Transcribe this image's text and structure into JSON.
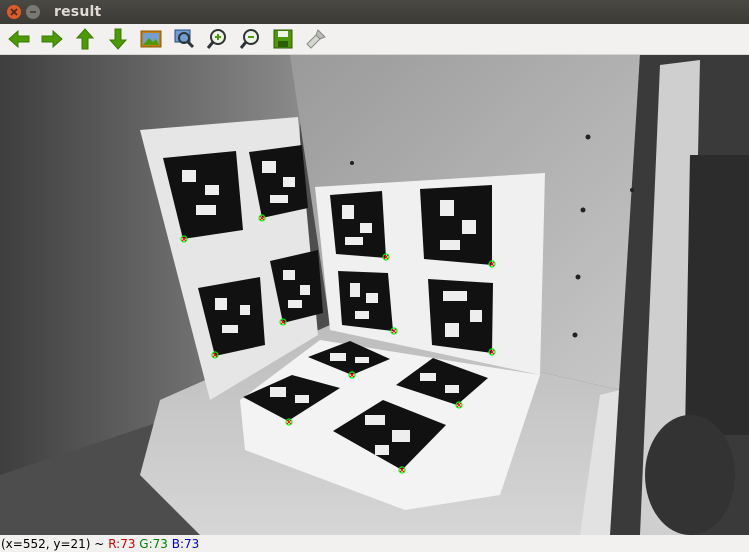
{
  "window": {
    "title": "result",
    "close_icon": "close-icon",
    "minimize_icon": "minimize-icon"
  },
  "toolbar": {
    "buttons": [
      {
        "id": "pan-left",
        "icon": "arrow-left-icon"
      },
      {
        "id": "pan-right",
        "icon": "arrow-right-icon"
      },
      {
        "id": "pan-up",
        "icon": "arrow-up-icon"
      },
      {
        "id": "pan-down",
        "icon": "arrow-down-icon"
      },
      {
        "id": "zoom-original",
        "icon": "image-icon"
      },
      {
        "id": "zoom-fit",
        "icon": "zoom-fit-icon"
      },
      {
        "id": "zoom-in",
        "icon": "zoom-in-icon"
      },
      {
        "id": "zoom-out",
        "icon": "zoom-out-icon"
      },
      {
        "id": "save",
        "icon": "save-icon"
      },
      {
        "id": "properties",
        "icon": "brush-icon"
      }
    ]
  },
  "status": {
    "coords": "(x=552, y=21) ~",
    "r": "R:73",
    "g": "G:73",
    "b": "B:73"
  },
  "image": {
    "content": "grayscale camera image of ArUco marker boards on shelf with detected corner points",
    "corner_marker_color": "#00ff00",
    "corner_cross_color": "#ff0000"
  }
}
